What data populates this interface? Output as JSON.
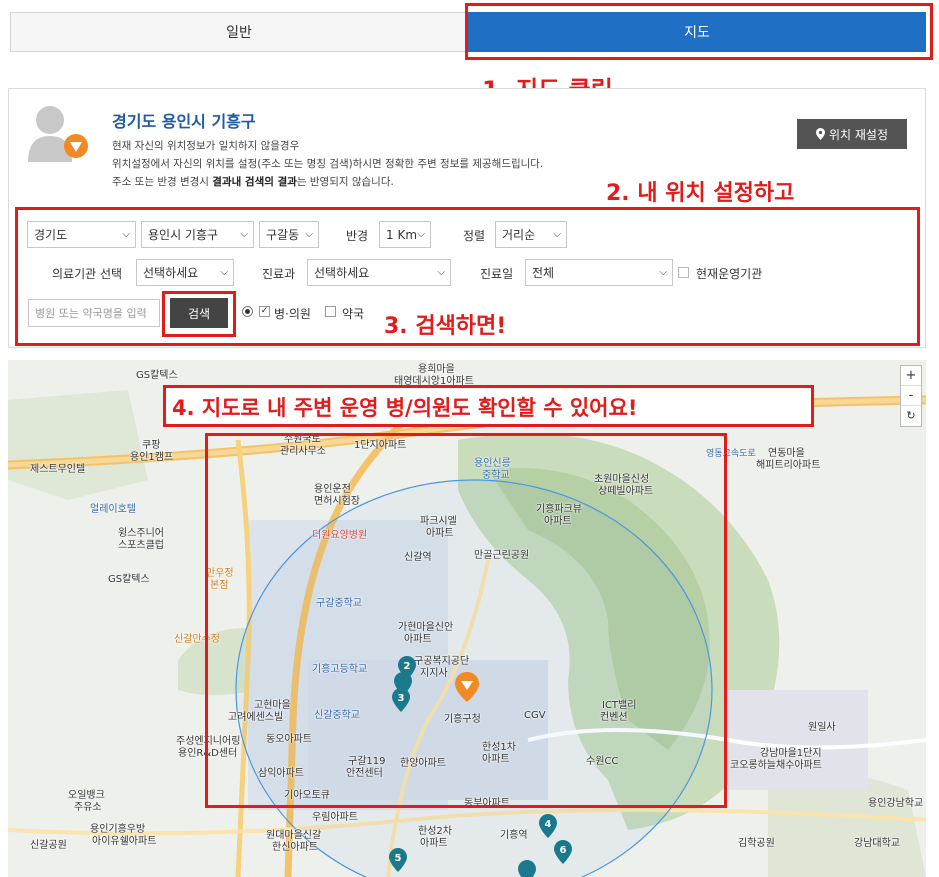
{
  "tabs": {
    "general": "일반",
    "map": "지도"
  },
  "annotations": {
    "step1": "1. 지도 클릭",
    "step2": "2. 내 위치 설정하고",
    "step3": "3. 검색하면!",
    "step4": "4. 지도로 내 주변 운영 병/의원도 확인할 수 있어요!"
  },
  "location": {
    "title": "경기도 용인시 기흥구",
    "line1": "현재 자신의 위치정보가 일치하지 않을경우",
    "line2": "위치설정에서 자신의 위치를 설정(주소 또는 명칭 검색)하시면 정확한 주변 정보를 제공해드립니다.",
    "line3_pre": "주소 또는 반경 변경시 ",
    "line3_bold": "결과내 검색의 결과",
    "line3_post": "는 반영되지 않습니다.",
    "reset_button": "위치 재설정"
  },
  "filters": {
    "province": "경기도",
    "city": "용인시 기흥구",
    "district": "구갈동",
    "radius_label": "반경",
    "radius": "1 Km",
    "sort_label": "정렬",
    "sort": "거리순",
    "facility_label": "의료기관 선택",
    "facility": "선택하세요",
    "dept_label": "진료과",
    "dept": "선택하세요",
    "day_label": "진료일",
    "day": "전체",
    "operating_label": "현재운영기관",
    "search_placeholder": "병원 또는 약국명을 입력",
    "search_button": "검색",
    "opt_clinic": "병·의원",
    "opt_pharmacy": "약국"
  },
  "map": {
    "zoom_in": "+",
    "zoom_out": "-",
    "labels": [
      "용희마을",
      "태영데시앙1아파트",
      "GS칼텍스",
      "쿠팡",
      "용인1캠프",
      "수원국토",
      "관리사무소",
      "1단지아파트",
      "용인신릉",
      "중학교",
      "제스트무인텔",
      "얼레이호텔",
      "윙스주니어",
      "스포츠클럽",
      "GS칼텍스",
      "용인운전",
      "면허시험장",
      "초원마을신성",
      "상떼빌아파트",
      "연동마을",
      "해피트리아파트",
      "파크시엘",
      "아파트",
      "기흥파크뷰",
      "아파트",
      "더원요양병원",
      "신갈역",
      "만골근린공원",
      "만우정",
      "본점",
      "구갈중학교",
      "가현마을신안",
      "아파트",
      "신갈만수정",
      "기흥고등학교",
      "구공복지공단",
      "지지사",
      "고현마을",
      "고려에센스빌",
      "신갈중학교",
      "기흥구청",
      "CGV",
      "ICT밸리",
      "컨벤션",
      "원일사",
      "주성엔지니어링",
      "용인R&D센터",
      "동오아파트",
      "구갈119",
      "안전센터",
      "한양아파트",
      "한성1차",
      "아파트",
      "수원CC",
      "강남마을1단지",
      "코오롱하늘채수아파트",
      "오일뱅크",
      "주유소",
      "삼익아파트",
      "기아오토큐",
      "동부아파트",
      "용인강남학교",
      "용인기흥우방",
      "아이유쉘아파트",
      "우림아파트",
      "원대마을신갈",
      "한신아파트",
      "한성2차",
      "아파트",
      "기흥역",
      "신갈공원",
      "김학공원",
      "강남대학교",
      "영동고속도로"
    ]
  },
  "colors": {
    "accent": "#1f6fc5",
    "annotation": "#e21b1b",
    "marker": "#1a7a8c",
    "my_location": "#f08a24"
  }
}
